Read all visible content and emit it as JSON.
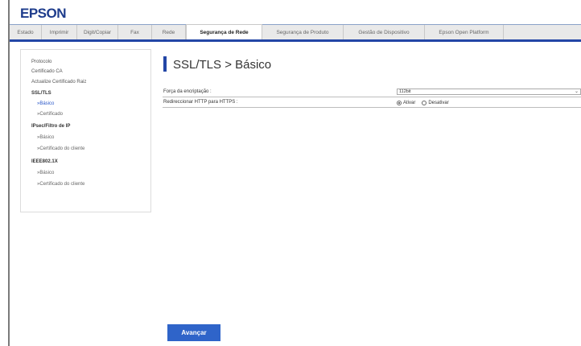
{
  "brand": {
    "logo": "EPSON",
    "accent": "#2346a6"
  },
  "tabs": [
    {
      "label": "Estado"
    },
    {
      "label": "Imprimir"
    },
    {
      "label": "Digit/Copiar"
    },
    {
      "label": "Fax"
    },
    {
      "label": "Rede"
    },
    {
      "label": "Segurança de Rede",
      "active": true
    },
    {
      "label": "Segurança de Produto"
    },
    {
      "label": "Gestão de Dispositivo"
    },
    {
      "label": "Epson Open Platform"
    }
  ],
  "sidebar": {
    "items": [
      {
        "label": "Protocolo"
      },
      {
        "label": "Certificado CA"
      },
      {
        "label": "Actualize Certificado Raiz"
      },
      {
        "label": "SSL/TLS"
      },
      {
        "label": "»Básico"
      },
      {
        "label": "»Certificado"
      },
      {
        "label": "IPsec/Filtro de IP"
      },
      {
        "label": "»Básico"
      },
      {
        "label": "»Certificado do cliente"
      },
      {
        "label": "IEEE802.1X"
      },
      {
        "label": "»Básico"
      },
      {
        "label": "»Certificado do cliente"
      }
    ]
  },
  "page": {
    "title": "SSL/TLS > Básico"
  },
  "form": {
    "encryption": {
      "label": "Força da encriptação :",
      "value": "112bit"
    },
    "redirect": {
      "label": "Redireccionar HTTP para HTTPS :",
      "option_on": "Ativar",
      "option_off": "Desativar",
      "selected": "Ativar"
    }
  },
  "actions": {
    "next_label": "Avançar"
  }
}
